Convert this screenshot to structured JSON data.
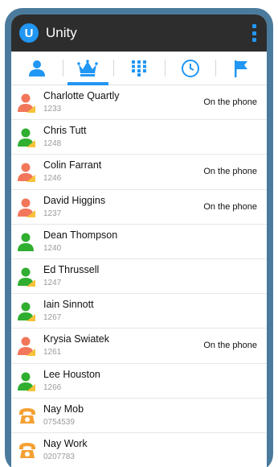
{
  "app": {
    "title": "Unity",
    "logo_letter": "U"
  },
  "colors": {
    "accent": "#2196f3",
    "available": "#2fae2f",
    "busy": "#f2765a",
    "phone": "#f5a033",
    "badge": "#f7c23a"
  },
  "tabs": [
    {
      "icon": "person-icon",
      "active": false
    },
    {
      "icon": "crown-icon",
      "active": true
    },
    {
      "icon": "dialpad-icon",
      "active": false
    },
    {
      "icon": "clock-icon",
      "active": false
    },
    {
      "icon": "flag-icon",
      "active": false
    }
  ],
  "contacts": [
    {
      "name": "Charlotte Quartly",
      "ext": "1233",
      "status": "On the phone",
      "presence": "busy",
      "icon": "person-icon"
    },
    {
      "name": "Chris Tutt",
      "ext": "1248",
      "status": "",
      "presence": "available",
      "icon": "person-icon"
    },
    {
      "name": "Colin Farrant",
      "ext": "1246",
      "status": "On the phone",
      "presence": "busy",
      "icon": "person-icon"
    },
    {
      "name": "David Higgins",
      "ext": "1237",
      "status": "On the phone",
      "presence": "busy",
      "icon": "person-icon"
    },
    {
      "name": "Dean Thompson",
      "ext": "1240",
      "status": "",
      "presence": "available-plain",
      "icon": "person-icon"
    },
    {
      "name": "Ed Thrussell",
      "ext": "1247",
      "status": "",
      "presence": "available",
      "icon": "person-icon"
    },
    {
      "name": "Iain Sinnott",
      "ext": "1267",
      "status": "",
      "presence": "available",
      "icon": "person-icon"
    },
    {
      "name": "Krysia Swiatek",
      "ext": "1261",
      "status": "On the phone",
      "presence": "busy",
      "icon": "person-icon"
    },
    {
      "name": "Lee Houston",
      "ext": "1266",
      "status": "",
      "presence": "available",
      "icon": "person-icon"
    },
    {
      "name": "Nay Mob",
      "ext": "0754539",
      "status": "",
      "presence": "phone",
      "icon": "telephone-icon"
    },
    {
      "name": "Nay Work",
      "ext": "0207783",
      "status": "",
      "presence": "phone",
      "icon": "telephone-icon"
    }
  ]
}
